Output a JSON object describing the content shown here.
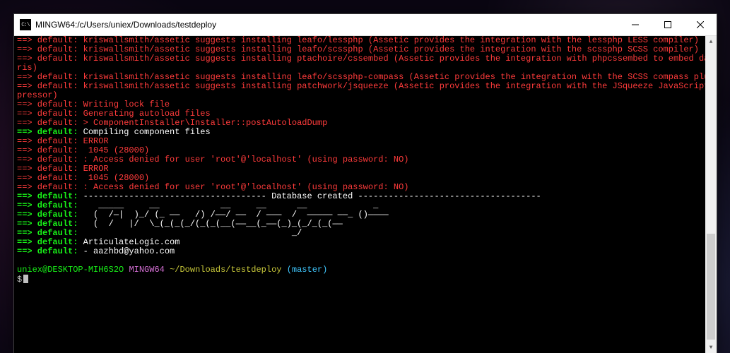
{
  "window": {
    "title": "MINGW64:/c/Users/uniex/Downloads/testdeploy",
    "icon_label": "C:\\"
  },
  "colors": {
    "red": "#ff3b3b",
    "green_bold": "#18f018",
    "white": "#ffffff",
    "prompt_user": "#18f018",
    "prompt_mingw": "#d670d6",
    "prompt_path": "#c8c83a",
    "prompt_branch": "#40c8ff"
  },
  "lines": [
    {
      "cls": "c-red",
      "text": "==> default: kriswallsmith/assetic suggests installing leafo/lessphp (Assetic provides the integration with the lessphp LESS compiler)"
    },
    {
      "cls": "c-red",
      "text": "==> default: kriswallsmith/assetic suggests installing leafo/scssphp (Assetic provides the integration with the scssphp SCSS compiler)"
    },
    {
      "cls": "c-red",
      "text": "==> default: kriswallsmith/assetic suggests installing ptachoire/cssembed (Assetic provides the integration with phpcssembed to embed data uris)"
    },
    {
      "cls": "c-red",
      "text": "==> default: kriswallsmith/assetic suggests installing leafo/scssphp-compass (Assetic provides the integration with the SCSS compass plugin)"
    },
    {
      "cls": "c-red",
      "text": "==> default: kriswallsmith/assetic suggests installing patchwork/jsqueeze (Assetic provides the integration with the JSqueeze JavaScript compressor)"
    },
    {
      "cls": "c-red",
      "text": "==> default: Writing lock file"
    },
    {
      "cls": "c-red",
      "text": "==> default: Generating autoload files"
    },
    {
      "cls": "c-red",
      "text": "==> default: > ComponentInstaller\\Installer::postAutoloadDump"
    },
    {
      "cls": "mix",
      "prefix": "==> default: ",
      "rest": "Compiling component files"
    },
    {
      "cls": "c-red",
      "text": "==> default: ERROR"
    },
    {
      "cls": "c-red",
      "text": "==> default:  1045 (28000)"
    },
    {
      "cls": "c-red",
      "text": "==> default: : Access denied for user 'root'@'localhost' (using password: NO)"
    },
    {
      "cls": "c-red",
      "text": "==> default: ERROR"
    },
    {
      "cls": "c-red",
      "text": "==> default:  1045 (28000)"
    },
    {
      "cls": "c-red",
      "text": "==> default: : Access denied for user 'root'@'localhost' (using password: NO)"
    },
    {
      "cls": "mix",
      "prefix": "==> default: ",
      "rest": "------------------------------------ Database created ------------------------------------"
    },
    {
      "cls": "mix",
      "prefix": "==> default: ",
      "rest": "   _____     __            __     __      __             _   "
    },
    {
      "cls": "mix",
      "prefix": "==> default: ",
      "rest": "  (  /―|  )_/ (_ ――   /) /――/ ――  / ―――  /  ――――― ――_ ()――――  "
    },
    {
      "cls": "mix",
      "prefix": "==> default: ",
      "rest": "  (  /   |/  \\_(_(_(_/(_(_(__(――__(_――(_)_(_/_(_(――     "
    },
    {
      "cls": "mix",
      "prefix": "==> default: ",
      "rest": "                                         _/       "
    },
    {
      "cls": "mix",
      "prefix": "==> default: ",
      "rest": "ArticulateLogic.com"
    },
    {
      "cls": "mix",
      "prefix": "==> default: ",
      "rest": "- aazhbd@yahoo.com"
    }
  ],
  "prompt": {
    "user_host": "uniex@DESKTOP-MIH6S2O",
    "mingw": "MINGW64",
    "path": "~/Downloads/testdeploy",
    "branch": "(master)",
    "symbol": "$"
  }
}
